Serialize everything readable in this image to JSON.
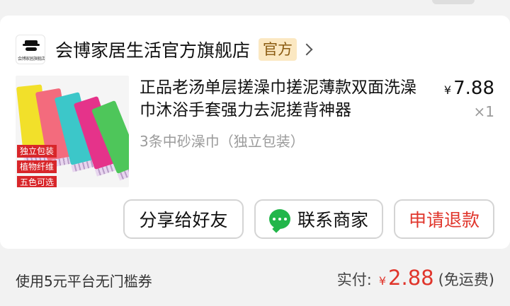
{
  "store": {
    "name": "会博家居生活官方旗舰店",
    "tag": "官方",
    "logo_text": "会博家居旗舰店"
  },
  "product": {
    "title": "正品老汤单层搓澡巾搓泥薄款双面洗澡巾沐浴手套强力去泥搓背神器",
    "variant": "3条中砂澡巾（独立包装）",
    "currency": "¥",
    "price": "7.88",
    "quantity": "×1",
    "image_badges": [
      "独立包装",
      "植物纤维",
      "五色可选"
    ],
    "image_towel_colors": [
      "#f2e02a",
      "#f36b7d",
      "#3cc7c9",
      "#e5338a",
      "#4ec65a"
    ]
  },
  "actions": {
    "share": "分享给好友",
    "contact": "联系商家",
    "refund": "申请退款"
  },
  "footer": {
    "coupon": "使用5元平台无门槛券",
    "paid_label": "实付:",
    "currency": "¥",
    "paid_amount": "2.88",
    "shipping": "(免运费)"
  },
  "colors": {
    "accent_red": "#e0352b",
    "chat_green": "#22b64a",
    "tag_bg": "#fbe8c2"
  }
}
